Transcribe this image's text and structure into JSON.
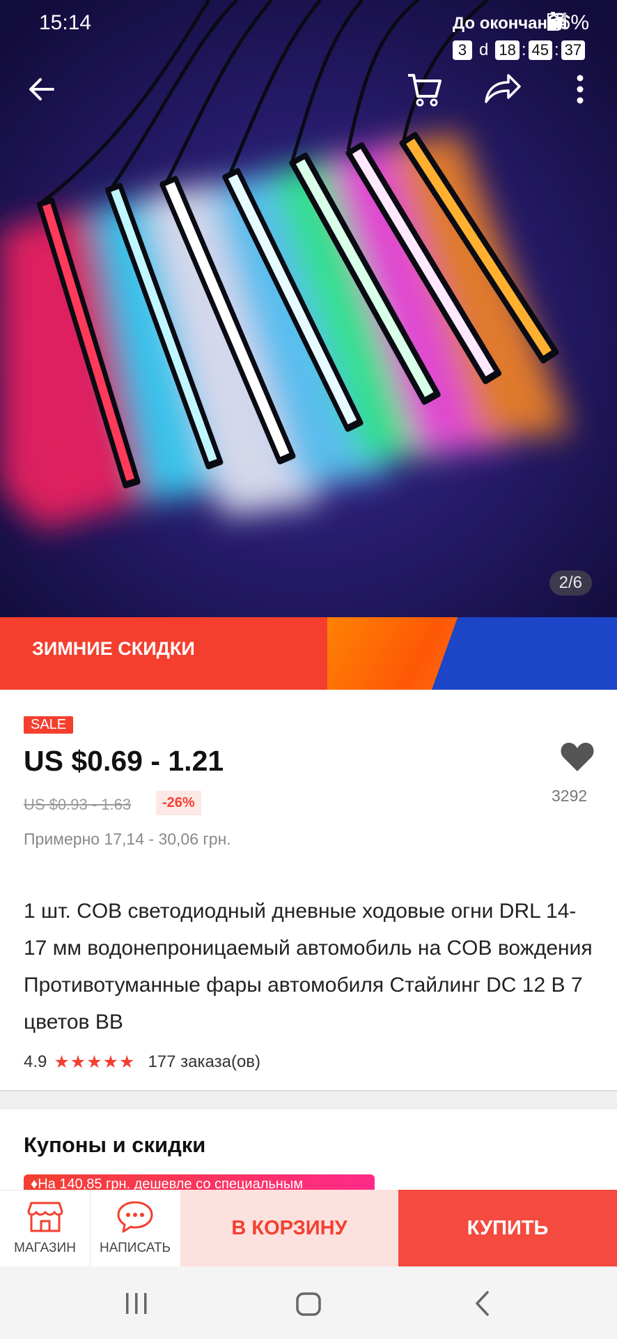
{
  "status": {
    "time": "15:14",
    "battery": "66%"
  },
  "hero": {
    "page_counter": "2/6"
  },
  "promo": {
    "title": "ЗИМНИЕ СКИДКИ",
    "end_label": "До окончания",
    "days": "3",
    "days_unit": "d",
    "hours": "18",
    "minutes": "45",
    "seconds": "37",
    "sep": ":"
  },
  "product": {
    "sale_badge": "SALE",
    "price": "US $0.69 - 1.21",
    "old_price": "US $0.93 - 1.63",
    "discount": "-26%",
    "approx": "Примерно 17,14 - 30,06 грн.",
    "wishlist_count": "3292",
    "title": "1 шт. COB светодиодный дневные ходовые огни DRL 14-17 мм водонепроницаемый автомобиль на COB вождения Противотуманные фары автомобиля Стайлинг DC 12 В 7 цветов BB",
    "rating": "4.9",
    "stars": "★★★★★",
    "orders": "177 заказа(ов)"
  },
  "coupons": {
    "title": "Купоны и скидки",
    "strip_text": "♦На 140,85 грн. дешевле со специальным"
  },
  "actions": {
    "shop_label": "МАГАЗИН",
    "message_label": "НАПИСАТЬ",
    "cart_label": "В КОРЗИНУ",
    "buy_label": "КУПИТЬ"
  },
  "colors": {
    "accent": "#f43f2f",
    "promo_blue": "#1c45c8"
  },
  "icons": [
    "back-arrow-icon",
    "cart-icon",
    "share-icon",
    "more-vert-icon",
    "heart-icon",
    "store-icon",
    "chat-icon",
    "recent-apps-icon",
    "home-icon",
    "back-nav-icon"
  ]
}
